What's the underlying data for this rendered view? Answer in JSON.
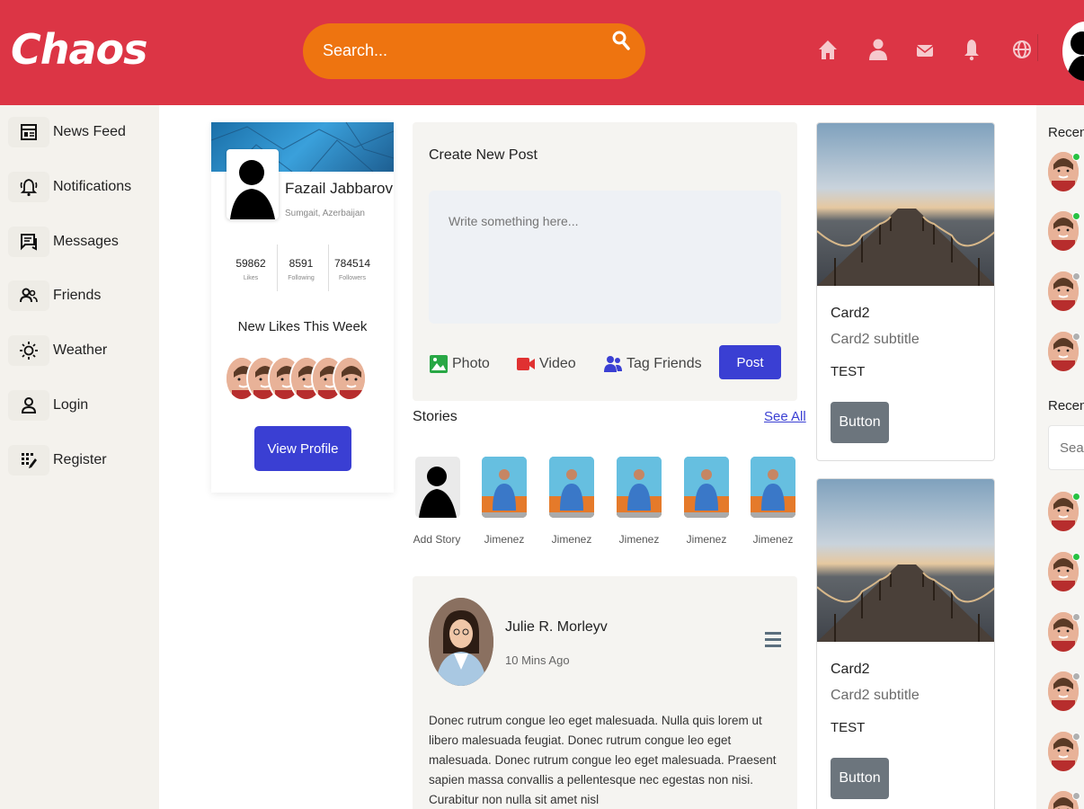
{
  "header": {
    "logo": "Chaos",
    "search_placeholder": "Search...",
    "icons": [
      "home-icon",
      "user-icon",
      "mail-icon",
      "bell-icon",
      "globe-icon"
    ]
  },
  "sidebar": {
    "items": [
      {
        "label": "News Feed",
        "icon": "newspaper-icon"
      },
      {
        "label": "Notifications",
        "icon": "bell-ring-icon"
      },
      {
        "label": "Messages",
        "icon": "messages-icon"
      },
      {
        "label": "Friends",
        "icon": "friends-icon"
      },
      {
        "label": "Weather",
        "icon": "sun-icon"
      },
      {
        "label": "Login",
        "icon": "login-user-icon"
      },
      {
        "label": "Register",
        "icon": "register-icon"
      }
    ]
  },
  "profile": {
    "name": "Fazail Jabbarov",
    "location": "Sumgait, Azerbaijan",
    "stats": [
      {
        "value": "59862",
        "label": "Likes"
      },
      {
        "value": "8591",
        "label": "Following"
      },
      {
        "value": "784514",
        "label": "Followers"
      }
    ],
    "new_likes_title": "New Likes This Week",
    "view_profile": "View Profile"
  },
  "create_post": {
    "title": "Create New Post",
    "placeholder": "Write something here...",
    "photo": "Photo",
    "video": "Video",
    "tag_friends": "Tag Friends",
    "post_button": "Post"
  },
  "stories": {
    "title": "Stories",
    "see_all": "See All",
    "items": [
      "Add Story",
      "Jimenez",
      "Jimenez",
      "Jimenez",
      "Jimenez",
      "Jimenez"
    ]
  },
  "post": {
    "author": "Julie R. Morleyv",
    "time": "10 Mins Ago",
    "text": "Donec rutrum congue leo eget malesuada. Nulla quis lorem ut libero malesuada feugiat. Donec rutrum congue leo eget malesuada. Donec rutrum congue leo eget malesuada. Praesent sapien massa convallis a pellentesque nec egestas non nisi. Curabitur non nulla sit amet nisl"
  },
  "cards": [
    {
      "title": "Card2",
      "subtitle": "Card2 subtitle",
      "text": "TEST",
      "button": "Button"
    },
    {
      "title": "Card2",
      "subtitle": "Card2 subtitle",
      "text": "TEST",
      "button": "Button"
    }
  ],
  "right": {
    "recent1": "Recent",
    "recent2": "Recent",
    "search_placeholder": "Search"
  },
  "colors": {
    "header": "#dc3545",
    "search": "#ee7410",
    "primary": "#3a3fd3",
    "online": "#28c244",
    "offline": "#b0b0b0"
  }
}
